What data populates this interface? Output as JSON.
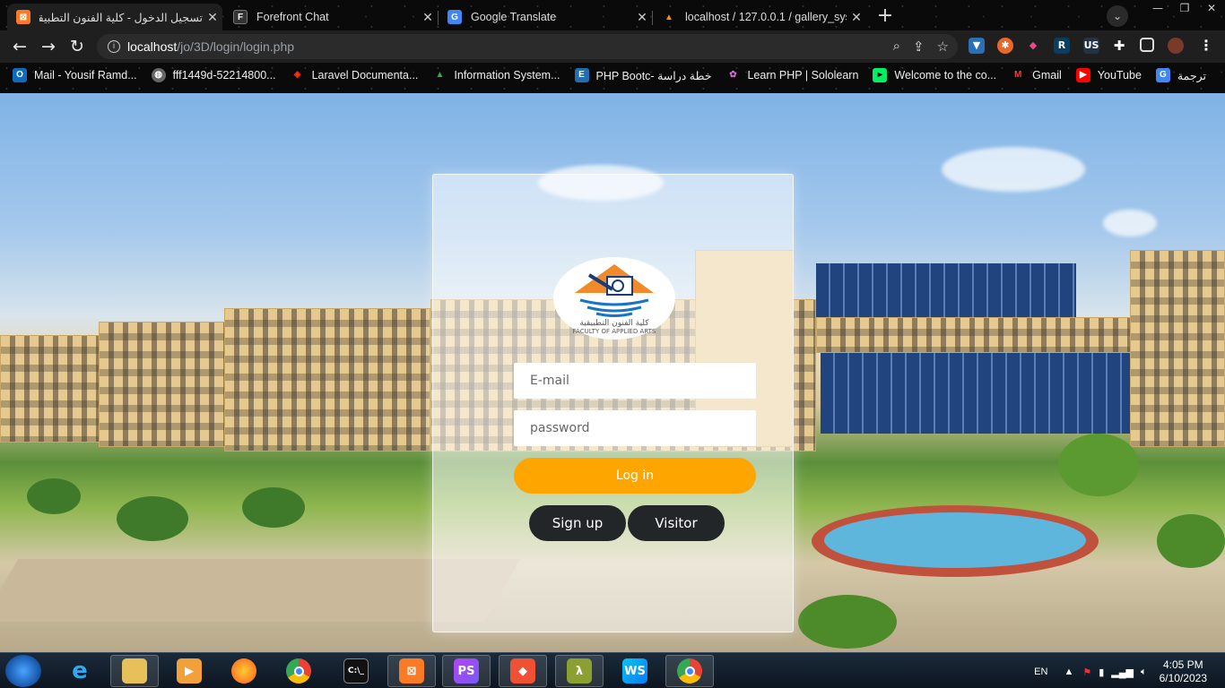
{
  "tabs": [
    {
      "title": "تسجيل الدخول - كلية الفنون التطبيقية",
      "icon": "xampp-icon",
      "active": true
    },
    {
      "title": "Forefront Chat",
      "icon": "forefront-icon"
    },
    {
      "title": "Google Translate",
      "icon": "google-translate-icon"
    },
    {
      "title": "localhost / 127.0.0.1 / gallery_sys",
      "icon": "phpmyadmin-icon"
    }
  ],
  "address": {
    "host": "localhost",
    "path": "/jo/3D/login/login.php"
  },
  "bookmarks": [
    {
      "label": "Mail - Yousif Ramd...",
      "icon": "outlook-icon"
    },
    {
      "label": "fff1449d-52214800...",
      "icon": "globe-icon"
    },
    {
      "label": "Laravel Documenta...",
      "icon": "laravel-icon"
    },
    {
      "label": "Information System...",
      "icon": "google-drive-icon"
    },
    {
      "label": "PHP Bootc- خطة دراسة",
      "icon": "elzero-icon"
    },
    {
      "label": "Learn PHP | Sololearn",
      "icon": "sololearn-icon"
    },
    {
      "label": "Welcome to the co...",
      "icon": "datacamp-icon"
    },
    {
      "label": "Gmail",
      "icon": "gmail-icon"
    },
    {
      "label": "YouTube",
      "icon": "youtube-icon"
    },
    {
      "label": "ترجمة",
      "icon": "google-translate-icon"
    }
  ],
  "login": {
    "logo_text_ar": "كلية الفنون التطبيقية",
    "logo_text_en": "FACULTY OF APPLIED ARTS",
    "email_placeholder": "E-mail",
    "password_placeholder": "password",
    "login_label": "Log in",
    "signup_label": "Sign up",
    "visitor_label": "Visitor"
  },
  "taskbar": {
    "language": "EN",
    "time": "4:05 PM",
    "date": "6/10/2023",
    "apps": [
      "internet-explorer",
      "file-explorer",
      "media-player",
      "firefox",
      "chrome",
      "cmd",
      "xampp",
      "phpstorm",
      "git",
      "lambda-app",
      "webstorm",
      "chrome-active"
    ]
  },
  "colors": {
    "login_button": "#ffa500",
    "dark_button": "#222629"
  }
}
